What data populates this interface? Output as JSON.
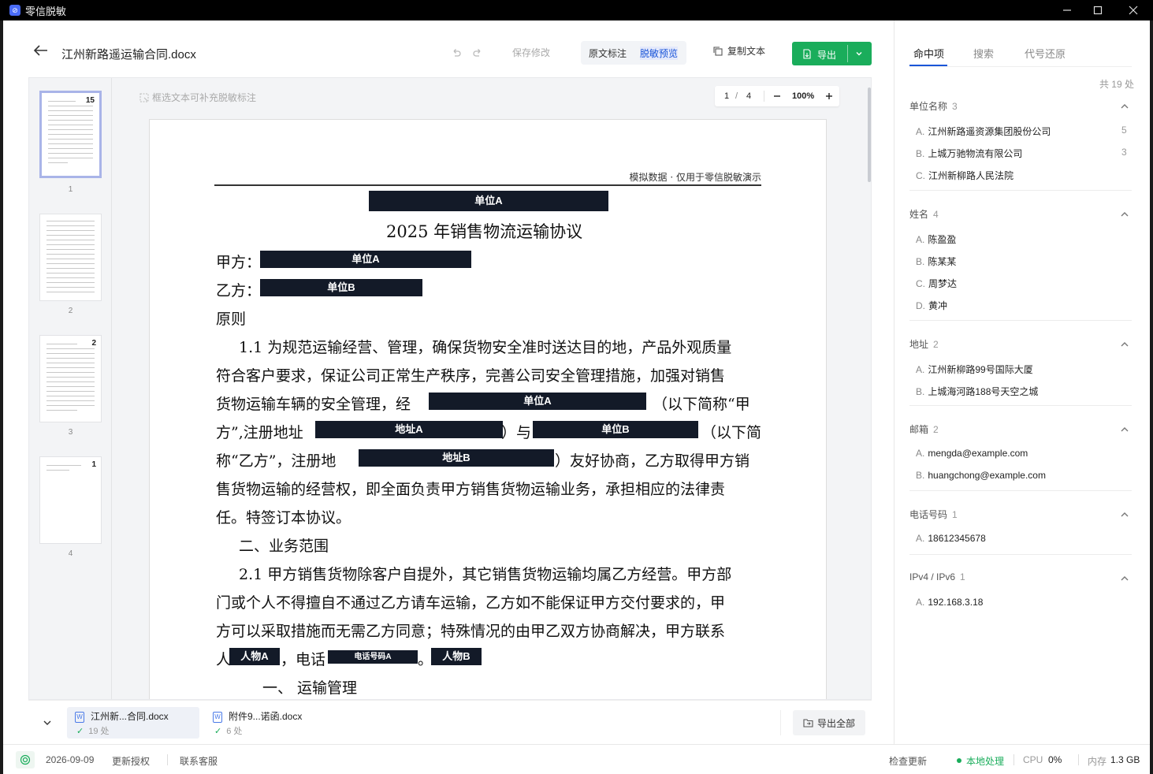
{
  "window": {
    "title": "零信脱敏"
  },
  "toolbar": {
    "doc_title": "江州新路遥运输合同.docx",
    "save_label": "保存修改",
    "view_original": "原文标注",
    "view_preview": "脱敏预览",
    "copy_text": "复制文本",
    "export": "导出"
  },
  "viewer": {
    "hint": "框选文本可补充脱敏标注",
    "page_current": "1",
    "page_sep": "/",
    "page_total": "4",
    "zoom": "100%",
    "thumbs": [
      {
        "num": "1",
        "badge": "15"
      },
      {
        "num": "2",
        "badge": ""
      },
      {
        "num": "3",
        "badge": "2"
      },
      {
        "num": "4",
        "badge": "1"
      }
    ]
  },
  "document": {
    "header": "模拟数据 · 仅用于零信脱敏演示",
    "redactions": {
      "unit_a": "单位A",
      "unit_b": "单位B",
      "addr_a": "地址A",
      "addr_b": "地址B",
      "person_a": "人物A",
      "person_b": "人物B",
      "phone_a": "电话号码A"
    },
    "title": "2025 年销售物流运输协议",
    "party_a": "甲方：",
    "party_b": "乙方：",
    "section_principle": "原则",
    "l1": "1.1 为规范运输经营、管理，确保货物安全准时送达目的地，产品外观质量",
    "l2": "符合客户要求，保证公司正常生产秩序，完善公司安全管理措施，加强对销售",
    "l3a": "货物运输车辆的安全管理，经",
    "l3b": "（以下简称“甲",
    "l4a": "方”,注册地址",
    "l4b": "）与",
    "l4c": "（以下简",
    "l5a": "称“乙方”，注册地",
    "l5b": "）友好协商，乙方取得甲方销",
    "l6": "售货物运输的经营权，即全面负责甲方销售货物运输业务，承担相应的法律责",
    "l7": "任。特签订本协议。",
    "section2": "二、业务范围",
    "l8": "2.1 甲方销售货物除客户自提外，其它销售货物运输均属乙方经营。甲方部",
    "l9": "门或个人不得擅自不通过乙方请车运输，乙方如不能保证甲方交付要求的，甲",
    "l10": "方可以采取措施而无需乙方同意；特殊情况的由甲乙双方协商解决，甲方联系",
    "l11a": "人",
    "l11b": "，电话",
    "l11c": "。",
    "section3": "一、    运输管理"
  },
  "files": [
    {
      "name": "江州新...合同.docx",
      "count": "19 处"
    },
    {
      "name": "附件9...诺函.docx",
      "count": "6 处"
    }
  ],
  "export_all": "导出全部",
  "sidebar": {
    "tabs": [
      "命中项",
      "搜索",
      "代号还原"
    ],
    "total": "共 19 处",
    "groups": [
      {
        "title": "单位名称",
        "count": "3",
        "items": [
          {
            "letter": "A.",
            "text": "江州新路遥资源集团股份公司",
            "num": "5"
          },
          {
            "letter": "B.",
            "text": "上城万驰物流有限公司",
            "num": "3"
          },
          {
            "letter": "C.",
            "text": "江州新柳路人民法院",
            "num": ""
          }
        ]
      },
      {
        "title": "姓名",
        "count": "4",
        "items": [
          {
            "letter": "A.",
            "text": "陈盈盈",
            "num": ""
          },
          {
            "letter": "B.",
            "text": "陈某某",
            "num": ""
          },
          {
            "letter": "C.",
            "text": "周梦达",
            "num": ""
          },
          {
            "letter": "D.",
            "text": "黄冲",
            "num": ""
          }
        ]
      },
      {
        "title": "地址",
        "count": "2",
        "items": [
          {
            "letter": "A.",
            "text": "江州新柳路99号国际大厦",
            "num": ""
          },
          {
            "letter": "B.",
            "text": "上城海河路188号天空之城",
            "num": ""
          }
        ]
      },
      {
        "title": "邮箱",
        "count": "2",
        "items": [
          {
            "letter": "A.",
            "text": "mengda@example.com",
            "num": ""
          },
          {
            "letter": "B.",
            "text": "huangchong@example.com",
            "num": ""
          }
        ]
      },
      {
        "title": "电话号码",
        "count": "1",
        "items": [
          {
            "letter": "A.",
            "text": "18612345678",
            "num": ""
          }
        ]
      },
      {
        "title": "IPv4 / IPv6",
        "count": "1",
        "items": [
          {
            "letter": "A.",
            "text": "192.168.3.18",
            "num": ""
          }
        ]
      }
    ]
  },
  "status": {
    "date": "2026-09-09",
    "update_license": "更新授权",
    "contact": "联系客服",
    "check_update": "检查更新",
    "local": "本地处理",
    "cpu_label": "CPU",
    "cpu_value": "0%",
    "mem_label": "内存",
    "mem_value": "1.3 GB"
  },
  "colors": {
    "accent": "#1a55d8",
    "export_green": "#1aad5b",
    "redact": "#131a28"
  }
}
